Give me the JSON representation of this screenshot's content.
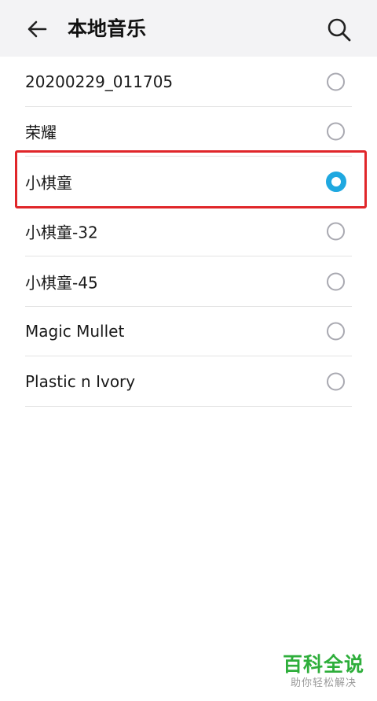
{
  "header": {
    "title": "本地音乐",
    "back_icon": "arrow-left-icon",
    "search_icon": "search-icon"
  },
  "list": {
    "items": [
      {
        "label": "20200229_011705",
        "selected": false
      },
      {
        "label": "荣耀",
        "selected": false
      },
      {
        "label": "小棋童",
        "selected": true
      },
      {
        "label": "小棋童-32",
        "selected": false
      },
      {
        "label": "小棋童-45",
        "selected": false
      },
      {
        "label": "Magic Mullet",
        "selected": false
      },
      {
        "label": "Plastic n Ivory",
        "selected": false
      }
    ]
  },
  "colors": {
    "accent": "#1fa8e0",
    "highlight": "#e0262a",
    "header_bg": "#f3f3f5"
  },
  "watermark": {
    "main": "百科全说",
    "sub": "助你轻松解决"
  }
}
